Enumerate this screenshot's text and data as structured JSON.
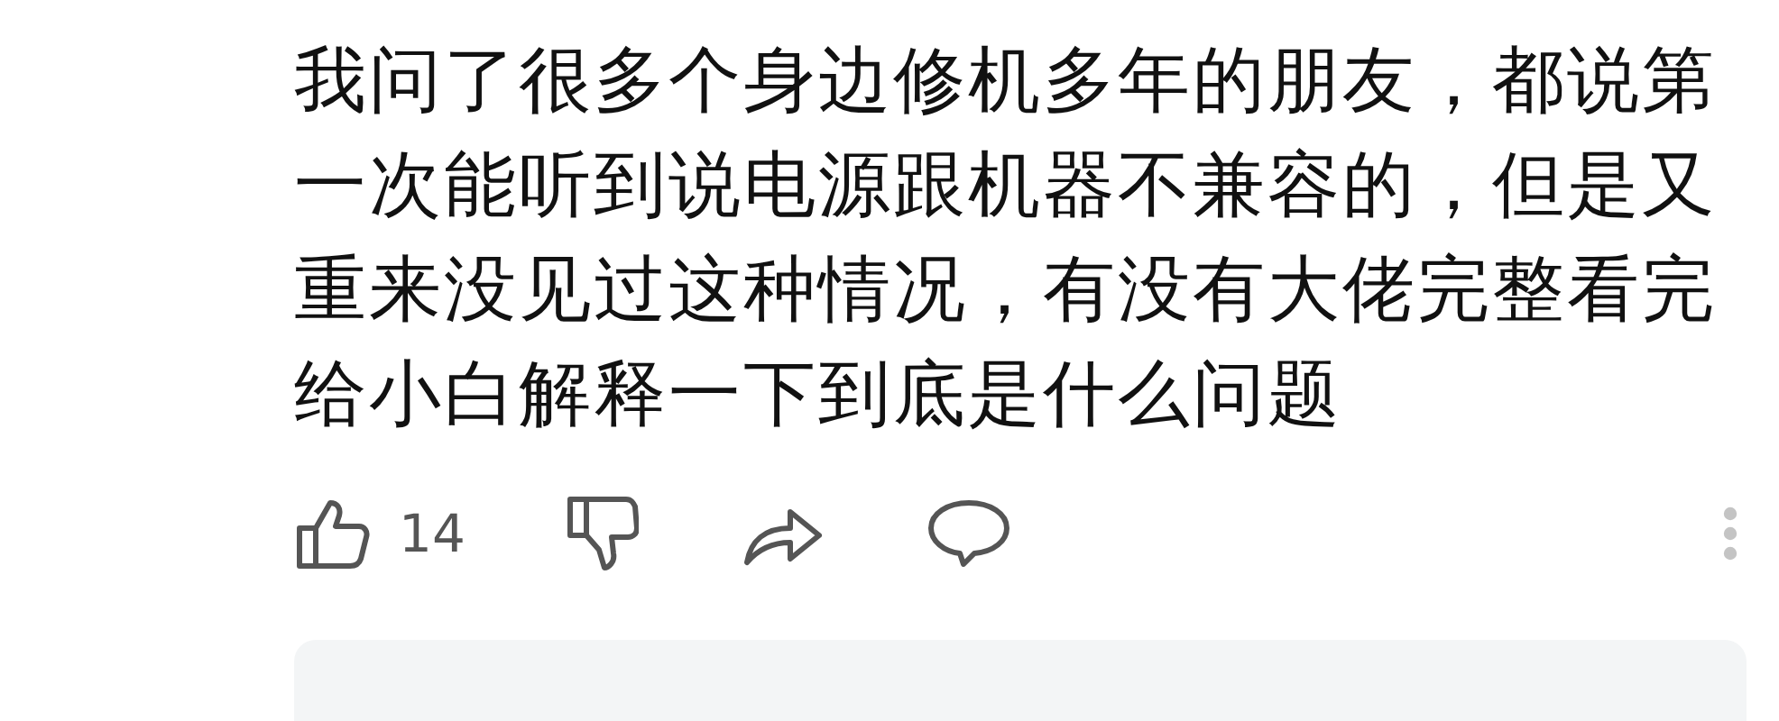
{
  "comment": {
    "text": "我问了很多个身边修机多年的朋友，都说第一次能听到说电源跟机器不兼容的，但是又重来没见过这种情况，有没有大佬完整看完给小白解释一下到底是什么问题"
  },
  "actions": {
    "like_count": "14"
  }
}
